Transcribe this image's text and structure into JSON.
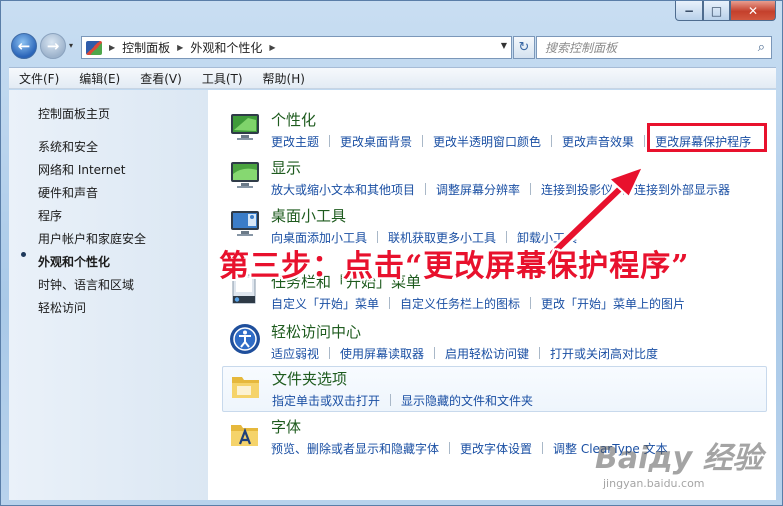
{
  "window": {
    "min": "−",
    "max": "□",
    "close": "✕"
  },
  "nav": {
    "back_icon": "←",
    "forward_icon": "→",
    "recent_icon": "▾"
  },
  "address": {
    "segments": [
      "控制面板",
      "外观和个性化"
    ],
    "sep": "▶",
    "dropdown_icon": "▼",
    "refresh_icon": "↻"
  },
  "search": {
    "placeholder": "搜索控制面板",
    "icon": "⌕"
  },
  "menu": [
    "文件(F)",
    "编辑(E)",
    "查看(V)",
    "工具(T)",
    "帮助(H)"
  ],
  "sidebar": {
    "home": "控制面板主页",
    "items": [
      "系统和安全",
      "网络和 Internet",
      "硬件和声音",
      "程序",
      "用户帐户和家庭安全",
      "外观和个性化",
      "时钟、语言和区域",
      "轻松访问"
    ]
  },
  "categories": [
    {
      "title": "个性化",
      "icon": "monitor-personalize-icon",
      "links": [
        "更改主题",
        "更改桌面背景",
        "更改半透明窗口颜色",
        "更改声音效果",
        "更改屏幕保护程序"
      ]
    },
    {
      "title": "显示",
      "icon": "display-icon",
      "links": [
        "放大或缩小文本和其他项目",
        "调整屏幕分辨率",
        "连接到投影仪",
        "连接到外部显示器"
      ]
    },
    {
      "title": "桌面小工具",
      "icon": "gadgets-icon",
      "links": [
        "向桌面添加小工具",
        "联机获取更多小工具",
        "卸载小工具"
      ]
    },
    {
      "title": "任务栏和「开始」菜单",
      "icon": "taskbar-icon",
      "links": [
        "自定义「开始」菜单",
        "自定义任务栏上的图标",
        "更改「开始」菜单上的图片"
      ]
    },
    {
      "title": "轻松访问中心",
      "icon": "ease-of-access-icon",
      "links": [
        "适应弱视",
        "使用屏幕读取器",
        "启用轻松访问键",
        "打开或关闭高对比度"
      ]
    },
    {
      "title": "文件夹选项",
      "icon": "folder-options-icon",
      "links": [
        "指定单击或双击打开",
        "显示隐藏的文件和文件夹"
      ]
    },
    {
      "title": "字体",
      "icon": "fonts-icon",
      "links": [
        "预览、删除或者显示和隐藏字体",
        "更改字体设置",
        "调整 ClearType 文本"
      ]
    }
  ],
  "annotation": "第三步：点击“更改屏幕保护程序”",
  "watermark": {
    "big": "Baiду 经验",
    "small": "jingyan.baidu.com"
  },
  "colors": {
    "highlight": "#e8112d",
    "link": "#1a4fa3",
    "title": "#1e5b1e"
  }
}
